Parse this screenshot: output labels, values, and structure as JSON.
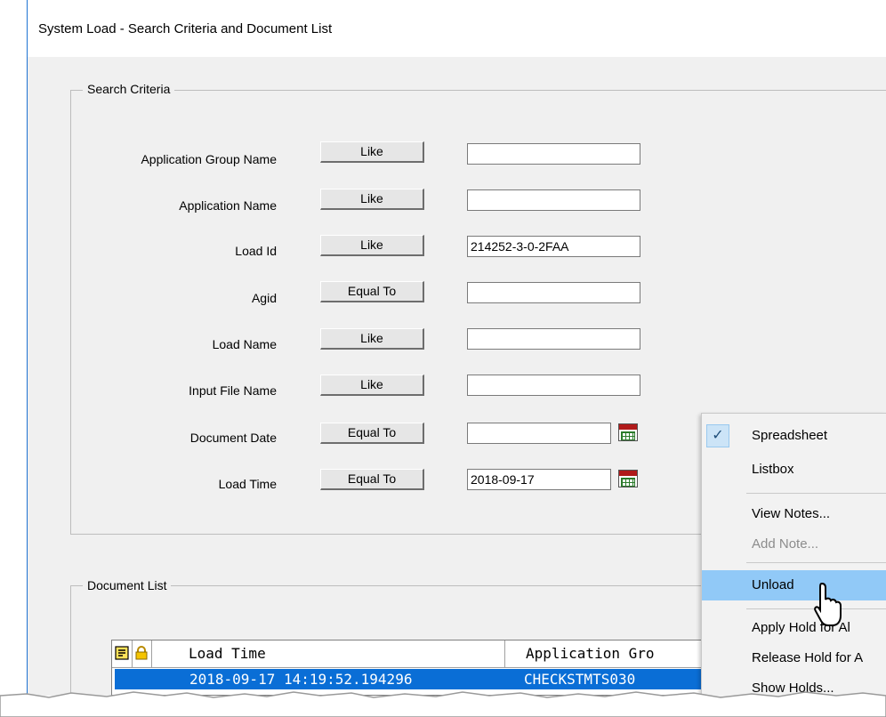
{
  "window": {
    "title": "System Load - Search Criteria and Document List"
  },
  "search_criteria": {
    "label": "Search Criteria",
    "fields": [
      {
        "label": "Application Group Name",
        "operator": "Like",
        "value": ""
      },
      {
        "label": "Application Name",
        "operator": "Like",
        "value": ""
      },
      {
        "label": "Load Id",
        "operator": "Like",
        "value": "214252-3-0-2FAA"
      },
      {
        "label": "Agid",
        "operator": "Equal To",
        "value": ""
      },
      {
        "label": "Load Name",
        "operator": "Like",
        "value": ""
      },
      {
        "label": "Input File Name",
        "operator": "Like",
        "value": ""
      },
      {
        "label": "Document Date",
        "operator": "Equal To",
        "value": ""
      },
      {
        "label": "Load Time",
        "operator": "Equal To",
        "value": "2018-09-17"
      }
    ]
  },
  "document_list": {
    "label": "Document List",
    "columns": [
      "Load Time",
      "Application Gro"
    ],
    "rows": [
      {
        "load_time": "2018-09-17 14:19:52.194296",
        "application_group": "CHECKSTMTS030",
        "selected": true
      }
    ]
  },
  "context_menu": {
    "items": [
      {
        "label": "Spreadsheet",
        "checked": true
      },
      {
        "label": "Listbox"
      },
      {
        "label": "View Notes..."
      },
      {
        "label": "Add Note...",
        "disabled": true
      },
      {
        "label": "Unload",
        "highlighted": true
      },
      {
        "label": "Apply Hold for Al"
      },
      {
        "label": "Release Hold for A"
      },
      {
        "label": "Show Holds..."
      }
    ]
  },
  "icons": {
    "note_icon": "note-icon",
    "lock_icon": "lock-icon",
    "calendar_icon": "calendar-icon",
    "check_icon": "checkmark-icon",
    "cursor": "mouse-pointer-icon"
  },
  "colors": {
    "selection": "#0a6ed6",
    "menu_highlight": "#91c9f7",
    "calendar_header": "#b01a1a"
  }
}
